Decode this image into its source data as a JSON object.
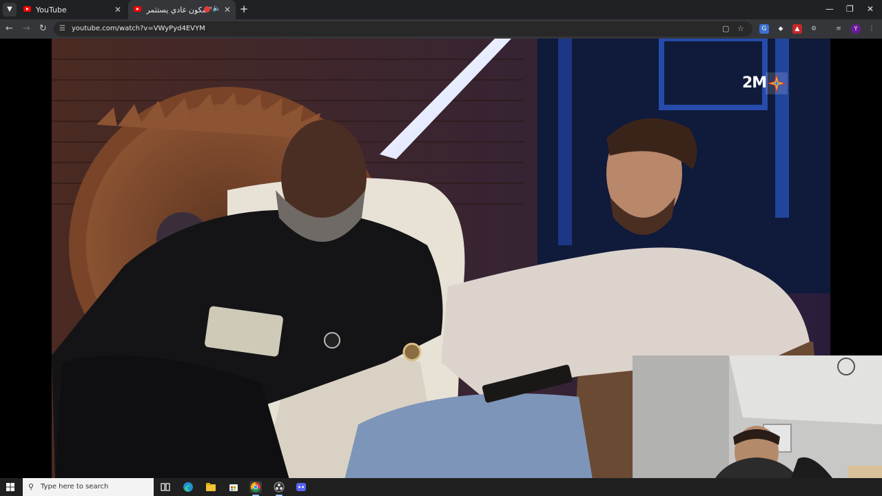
{
  "browser": {
    "tabs": [
      {
        "title": "YouTube",
        "close_label": "✕"
      },
      {
        "title": "\"شكون غادي يستثمر فمنا...",
        "close_label": "✕"
      }
    ],
    "tab_list_icon": "chevron-down-icon",
    "new_tab_label": "+",
    "window_controls": {
      "minimize": "—",
      "restore": "❐",
      "close": "✕"
    },
    "nav": {
      "back": "←",
      "forward": "→",
      "reload": "↻"
    },
    "url": "youtube.com/watch?v=VWyPyd4EVYM",
    "profile_initial": "Y"
  },
  "video": {
    "channel_logo_text": "2M"
  },
  "taskbar": {
    "search_placeholder": "Type here to search",
    "apps": [
      "task-view",
      "edge",
      "file-explorer",
      "store",
      "chrome",
      "obs",
      "discord"
    ],
    "accent": "#9ec5ff"
  },
  "colors": {
    "tab_strip": "#202124",
    "toolbar": "#35363a",
    "youtube_red": "#ff0000"
  }
}
